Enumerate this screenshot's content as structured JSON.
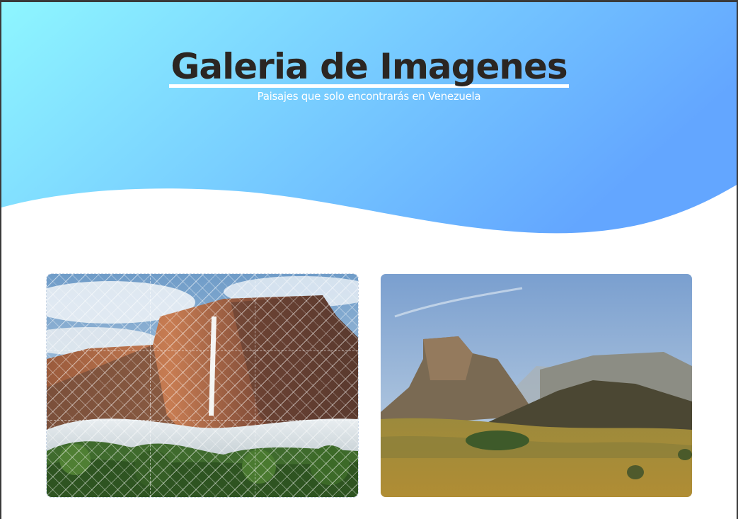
{
  "header": {
    "title": "Galeria de Imagenes",
    "subtitle": "Paisajes que solo encontrarás en Venezuela",
    "gradient_start": "#8ef6ff",
    "gradient_end": "#63a6ff"
  },
  "gallery": {
    "items": [
      {
        "description": "tepui-waterfall-photo"
      },
      {
        "description": "tepui-plateau-landscape-photo"
      }
    ]
  }
}
